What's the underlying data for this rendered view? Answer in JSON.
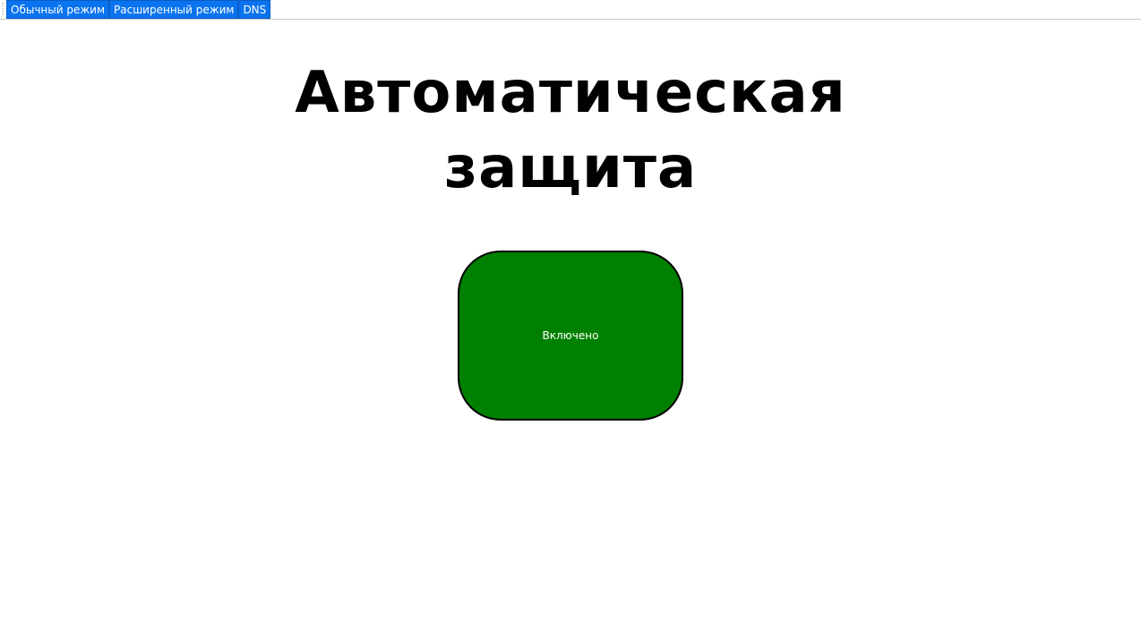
{
  "tabs": [
    {
      "label": "Обычный режим"
    },
    {
      "label": "Расширенный режим"
    },
    {
      "label": "DNS"
    }
  ],
  "main": {
    "title_line1": "Автоматическая",
    "title_line2": "защита",
    "toggle_label": "Включено"
  },
  "colors": {
    "tab_bg": "#0a74f0",
    "toggle_on": "#008000"
  }
}
